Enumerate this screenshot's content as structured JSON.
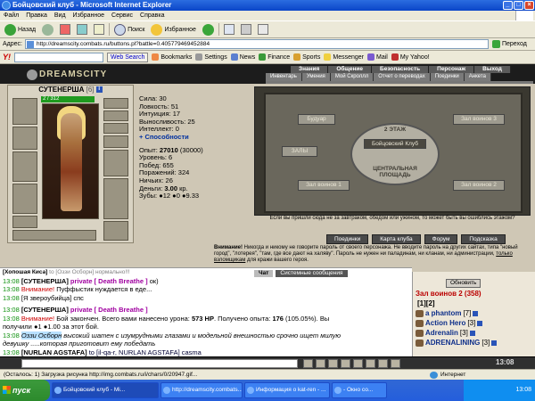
{
  "window": {
    "title": "Бойцовский клуб - Microsoft Internet Explorer"
  },
  "menu": [
    "Файл",
    "Правка",
    "Вид",
    "Избранное",
    "Сервис",
    "Справка"
  ],
  "toolbar": {
    "back": "Назад",
    "search": "Поиск",
    "favorites": "Избранное"
  },
  "address": {
    "label": "Адрес:",
    "url": "http://dreamscity.combats.ru/buttons.pl?battle=0.405779469452884",
    "go": "Переход"
  },
  "yahoo": {
    "logo": "Y!",
    "websearch": "Web Search",
    "items": [
      "Bookmarks",
      "Settings",
      "News",
      "Finance",
      "Sports",
      "Messenger",
      "Mail",
      "My Yahoo!"
    ]
  },
  "game": {
    "logo": "DREAMSCITY",
    "nav_top": [
      "Знания",
      "Общение",
      "Безопасность",
      "Персонаж",
      "Выход"
    ],
    "nav_sub": [
      "Инвентарь",
      "Умения",
      "Мой Скроллл",
      "Отчет о переводах",
      "Поединки",
      "Анкета"
    ],
    "character": {
      "name": "СУТЕНЕРША",
      "level": "[6]",
      "hp": "2 / 312"
    },
    "stats": {
      "sila": "Сила: 30",
      "lovkost": "Ловкость: 51",
      "intuicia": "Интуиция: 17",
      "vynoslivost": "Выносливость: 25",
      "intellekt": "Интеллект: 0",
      "sposobnosti": "+ Способности",
      "opyt_label": "Опыт:",
      "opyt_value": "27010",
      "opyt_next": "(30000)",
      "uroven": "Уровень: 6",
      "pobed": "Побед: 655",
      "porazheniy": "Поражений: 324",
      "nichih": "Ничьих: 26",
      "dengi_label": "Деньги:",
      "dengi_value": "3.00",
      "dengi_unit": "кр.",
      "zuby": "Зубы: ●12 ●0 ●9.33"
    },
    "map": {
      "rooms": {
        "boudoir": "Будуар",
        "zv3": "Зал воинов 3",
        "halls": "ЗАЛЫ",
        "zv1": "Зал воинов 1",
        "zv2": "Зал воинов 2"
      },
      "floor": "2 ЭТАЖ",
      "club": "Бойцовский Клуб",
      "plaza": "ЦЕНТРАЛЬНАЯ ПЛОЩАДЬ",
      "note": "Если вы пришли сюда не за завтраком, обедом или ужином, то может быть вы ошиблись этажом?"
    },
    "buttons": [
      "Поединки",
      "Карта клуба",
      "Форум",
      "Подсказка"
    ],
    "warning": {
      "bold": "Внимание!",
      "text1": " Никогда и никому не говорите пароль от своего персонажа. Не вводите пароль на других сайтах, типа \"новый город\", \"лотерея\", \"там, где все дают на халяву\". Пароль не нужен ни паладинам, ни кланам, ни администрации, ",
      "underline": "только взломщикам",
      "text2": " для кражи вашего героя."
    },
    "chat_tabs": [
      "Чат",
      "Системные сообщения"
    ],
    "chat": {
      "l1_name": "[Хопошая Киса]",
      "l1_rest": " to [Оззи Осборн] нормально!!!",
      "l2_time": "13:08",
      "l2_name": "[СУТЕНЕРША]",
      "l2_priv": "private [ Death Breathe ]",
      "l2_rest": " ок)",
      "l3_time": "13:08",
      "l3_red": "Внимание!",
      "l3_rest": " Пуффыстик нуждается в еде...",
      "l4_time": "13:08",
      "l4_rest": "[Я звероубийца] спс",
      "l5_time": "13:08",
      "l5_name": "[СУТЕНЕРША]",
      "l5_priv": "private [ Death Breathe ]",
      "l6_time": "13:08",
      "l6_red": "Внимание!",
      "l6_rest": " Бой закончен. Всего вами нанесено урона: ",
      "l6_dmg": "573 HP",
      "l6_mid": ". Получено опыта: ",
      "l6_exp": "176",
      "l6_pct": " (105.05%). Вы",
      "l7": "получили ●1 ●1.00 за этот бой.",
      "l8_time": "13:08",
      "l8_name": "Оззи Осборн",
      "l8_rest": " высокий шатен с изумрудными глазами и модельной внешностью срочно ищет милую",
      "l9": "девушку .....которая приготовит ему победать",
      "l10_time": "13:08",
      "l10_name": "[NURLAN AGSTAFA]",
      "l10_rest": " to [il-qa-r, NURLAN AGSTAFA] casma"
    },
    "room_list": {
      "refresh": "Обновить",
      "title": "Зал воинов 2 (358)",
      "page": "[1][2]",
      "players": [
        {
          "name": "a phantom",
          "level": "[7]"
        },
        {
          "name": "Action Hero",
          "level": "[3]"
        },
        {
          "name": "Adrenalin",
          "level": "[3]"
        },
        {
          "name": "ADRENALINING",
          "level": "[3]"
        }
      ]
    },
    "clock": "13:08"
  },
  "status_bar": {
    "text": "(Осталось: 1) Загрузка рисунка http://img.combats.ru/i/chars/0/20947.gif...",
    "zone": "Интернет"
  },
  "taskbar": {
    "start": "пуск",
    "tasks": [
      "Бойцовский клуб - Mi...",
      "http://dreamscity.combats...",
      "Информация о kat-ren - ...",
      "- Окно со..."
    ],
    "tray_time": "13:08"
  }
}
